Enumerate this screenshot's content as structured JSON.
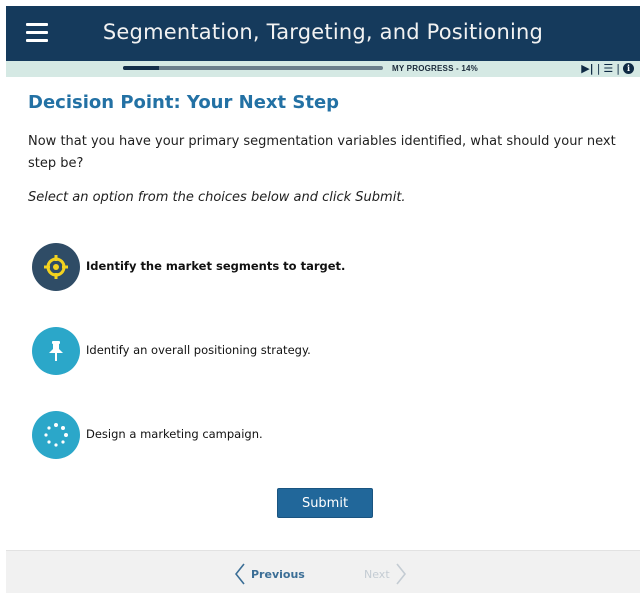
{
  "header": {
    "title": "Segmentation, Targeting, and Positioning",
    "menu_icon": "hamburger-menu-icon"
  },
  "progress": {
    "label": "MY PROGRESS - 14%",
    "value_percent": 14
  },
  "toolbar_icons": [
    "play-next-icon",
    "table-of-contents-icon",
    "info-icon"
  ],
  "main": {
    "heading": "Decision Point: Your Next Step",
    "prompt": "Now that you have your primary segmentation variables identified, what should your next step be?",
    "instruction": "Select an option from the choices below and click Submit."
  },
  "options": [
    {
      "label": "Identify the market segments to target.",
      "icon": "target-icon",
      "selected": true,
      "color": "#2f4c66"
    },
    {
      "label": "Identify an overall positioning strategy.",
      "icon": "pushpin-icon",
      "selected": false,
      "color": "#2ba7c9"
    },
    {
      "label": "Design a marketing campaign.",
      "icon": "dotted-circle-icon",
      "selected": false,
      "color": "#2ba7c9"
    }
  ],
  "submit_label": "Submit",
  "footer": {
    "previous_label": "Previous",
    "next_label": "Next"
  },
  "colors": {
    "header_bg": "#153a5c",
    "progress_strip_bg": "#d5e9e4",
    "heading": "#2371a4",
    "submit_bg": "#21679a",
    "target_accent": "#f3d21f"
  }
}
